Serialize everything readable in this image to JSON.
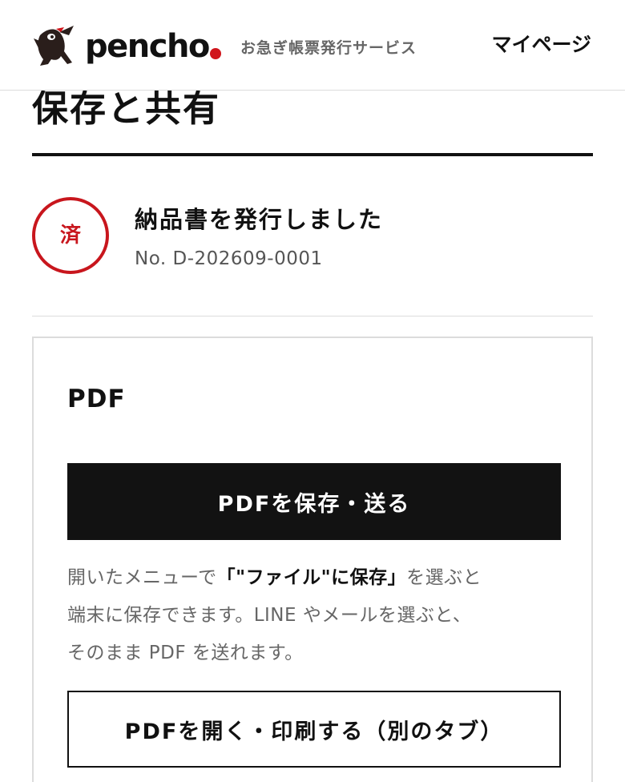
{
  "header": {
    "logo_text": "pencho",
    "tagline": "お急ぎ帳票発行サービス",
    "mypage_label": "マイページ",
    "colors": {
      "accent_red": "#d0151b"
    }
  },
  "page": {
    "title": "保存と共有"
  },
  "status": {
    "stamp_text": "済",
    "message": "納品書を発行しました",
    "document_number": "No. D-202609-0001",
    "colors": {
      "stamp_red": "#c8161d"
    }
  },
  "pdf_card": {
    "title": "PDF",
    "save_send_button": "PDFを保存・送る",
    "help": {
      "line1_pre": "開いたメニューで",
      "line1_bold": "「\"ファイル\"に保存」",
      "line1_post": "を選ぶと",
      "line2": "端末に保存できます。LINE やメールを選ぶと、",
      "line3": "そのまま PDF を送れます。"
    },
    "open_print_button": "PDFを開く・印刷する（別のタブ）"
  }
}
